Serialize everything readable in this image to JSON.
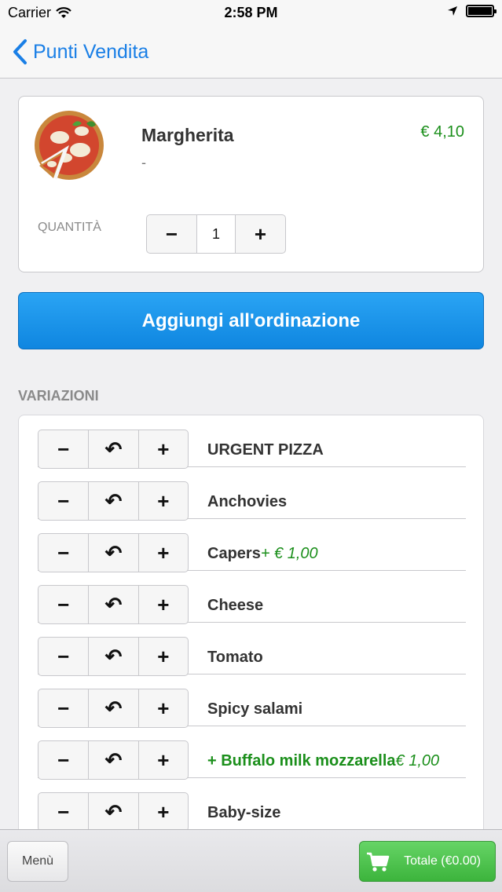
{
  "status_bar": {
    "carrier": "Carrier",
    "time": "2:58 PM",
    "icons": [
      "wifi-icon",
      "location-arrow-icon",
      "battery-icon"
    ]
  },
  "nav": {
    "back_label": "Punti Vendita",
    "back_icon": "chevron-left-icon",
    "accent": "#1a7fe6"
  },
  "product": {
    "name": "Margherita",
    "description": "-",
    "price": "€ 4,10",
    "image": "pizza-image",
    "quantity_label": "QUANTITÀ",
    "quantity_value": "1",
    "minus": "−",
    "plus": "+"
  },
  "add_button_label": "Aggiungi all'ordinazione",
  "variations_title": "VARIAZIONI",
  "stepper": {
    "minus": "−",
    "undo": "↶",
    "plus": "+"
  },
  "variations": [
    {
      "label": "URGENT PIZZA",
      "price": ""
    },
    {
      "label": "Anchovies",
      "price": ""
    },
    {
      "label": "Capers",
      "price": "+ € 1,00"
    },
    {
      "label": "Cheese",
      "price": ""
    },
    {
      "label": "Tomato",
      "price": ""
    },
    {
      "label": "Spicy salami",
      "price": ""
    },
    {
      "label": "+ Buffalo milk mozzarella",
      "price": "€ 1,00",
      "added": true
    },
    {
      "label": "Baby-size",
      "price": ""
    }
  ],
  "bottom_bar": {
    "menu_label": "Menù",
    "total_label": "Totale (€0.00)",
    "cart_icon": "cart-icon"
  },
  "colors": {
    "price_green": "#1b8f1b",
    "button_blue": "#1a8ef0",
    "total_green": "#4cc04c"
  }
}
